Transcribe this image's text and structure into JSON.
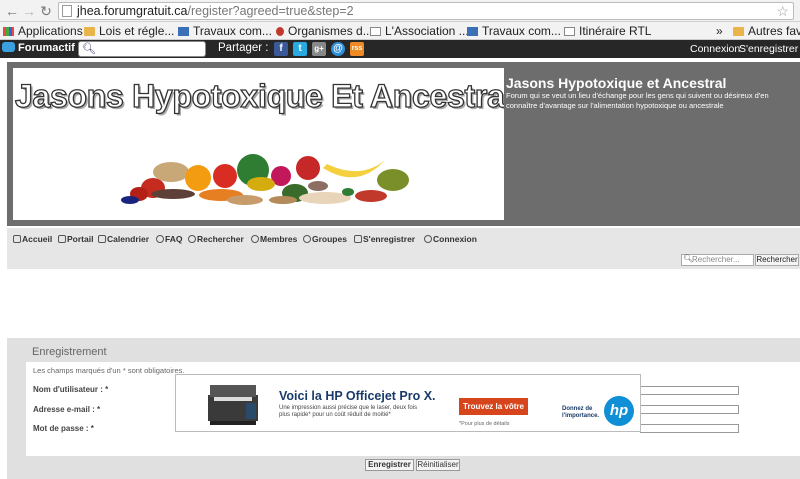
{
  "browser": {
    "url_host": "jhea.forumgratuit.ca",
    "url_path": "/register?agreed=true&step=2",
    "bookmarks": [
      {
        "label": "Applications",
        "icon": "apps-grid-icon"
      },
      {
        "label": "Lois et régle...",
        "icon": "folder-icon"
      },
      {
        "label": "Travaux com...",
        "icon": "blue-square-icon"
      },
      {
        "label": "Organismes d...",
        "icon": "red-pin-icon"
      },
      {
        "label": "L'Association ...",
        "icon": "page-icon"
      },
      {
        "label": "Travaux com...",
        "icon": "blue-square-icon"
      },
      {
        "label": "Itinéraire RTL",
        "icon": "page-icon"
      },
      {
        "label": "»",
        "icon": ""
      },
      {
        "label": "Autres favo",
        "icon": "folder-icon"
      }
    ]
  },
  "toolbar": {
    "brand": "Forumactif",
    "share_label": "Partager :",
    "share_icons": [
      "f",
      "t",
      "g+",
      "@",
      "rss"
    ],
    "login": "Connexion",
    "register": "S'enregistrer"
  },
  "header": {
    "banner_title": "Jasons Hypotoxique Et Ancestral",
    "site_title": "Jasons Hypotoxique et Ancestral",
    "site_description": "Forum qui se veut un lieu d'échange pour les gens qui suivent ou désireux d'en connaître d'avantage sur l'alimentation hypotoxique ou ancestrale"
  },
  "nav": {
    "items": [
      "Accueil",
      "Portail",
      "Calendrier",
      "FAQ",
      "Rechercher",
      "Membres",
      "Groupes",
      "S'enregistrer",
      "Connexion"
    ],
    "search_placeholder": "Rechercher...",
    "search_button": "Rechercher"
  },
  "registration": {
    "title": "Enregistrement",
    "required_note": "Les champs marqués d'un * sont obligatoires.",
    "fields": [
      "Nom d'utilisateur : *",
      "Adresse e-mail : *",
      "Mot de passe : *"
    ],
    "submit": "Enregistrer",
    "reset": "Réinitialiser"
  },
  "ad": {
    "headline": "Voici la HP Officejet Pro X.",
    "body": "Une impression aussi précise que le laser, deux fois plus rapide* pour un coût réduit de moitié*",
    "cta": "Trouvez la vôtre",
    "footnote": "*Pour plus de détails",
    "tagline": "Donnez de l'importance.",
    "logo": "hp"
  },
  "colors": {
    "toolbar_bg": "#272727",
    "header_bg": "#6d6d6d",
    "nav_bg": "#e6e6e6",
    "ad_cta": "#d6451b",
    "hp_blue": "#0e8fd6"
  }
}
